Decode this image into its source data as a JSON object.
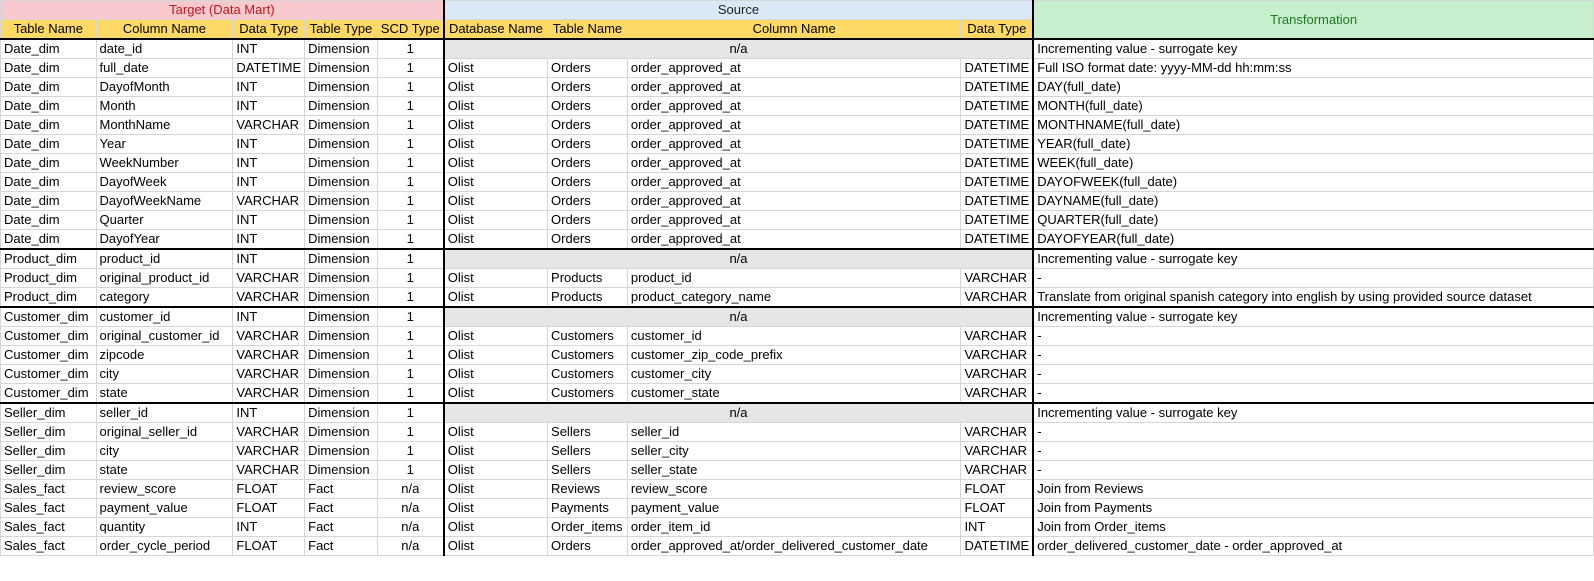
{
  "groups": {
    "target": "Target (Data Mart)",
    "source": "Source",
    "transformation": "Transformation"
  },
  "columns": {
    "target": [
      "Table Name",
      "Column Name",
      "Data Type",
      "Table Type",
      "SCD Type"
    ],
    "source": [
      "Database Name",
      "Table Name",
      "Column Name",
      "Data Type"
    ]
  },
  "colors": {
    "target_header_bg": "#f8c9cf",
    "target_header_text": "#c0181f",
    "source_header_bg": "#dbe9f7",
    "transformation_header_bg": "#c7efce",
    "transformation_header_text": "#1e7b1e",
    "column_header_bg": "#ffd966",
    "na_bg": "#e6e6e6"
  },
  "rows": [
    {
      "t": [
        "Date_dim",
        "date_id",
        "INT",
        "Dimension",
        "1"
      ],
      "na": "n/a",
      "x": "Incrementing value - surrogate key"
    },
    {
      "t": [
        "Date_dim",
        "full_date",
        "DATETIME",
        "Dimension",
        "1"
      ],
      "s": [
        "Olist",
        "Orders",
        "order_approved_at",
        "DATETIME"
      ],
      "x": "Full ISO format date: yyyy-MM-dd hh:mm:ss"
    },
    {
      "t": [
        "Date_dim",
        "DayofMonth",
        "INT",
        "Dimension",
        "1"
      ],
      "s": [
        "Olist",
        "Orders",
        "order_approved_at",
        "DATETIME"
      ],
      "x": "DAY(full_date)"
    },
    {
      "t": [
        "Date_dim",
        "Month",
        "INT",
        "Dimension",
        "1"
      ],
      "s": [
        "Olist",
        "Orders",
        "order_approved_at",
        "DATETIME"
      ],
      "x": "MONTH(full_date)"
    },
    {
      "t": [
        "Date_dim",
        "MonthName",
        "VARCHAR",
        "Dimension",
        "1"
      ],
      "s": [
        "Olist",
        "Orders",
        "order_approved_at",
        "DATETIME"
      ],
      "x": "MONTHNAME(full_date)"
    },
    {
      "t": [
        "Date_dim",
        "Year",
        "INT",
        "Dimension",
        "1"
      ],
      "s": [
        "Olist",
        "Orders",
        "order_approved_at",
        "DATETIME"
      ],
      "x": "YEAR(full_date)"
    },
    {
      "t": [
        "Date_dim",
        "WeekNumber",
        "INT",
        "Dimension",
        "1"
      ],
      "s": [
        "Olist",
        "Orders",
        "order_approved_at",
        "DATETIME"
      ],
      "x": "WEEK(full_date)"
    },
    {
      "t": [
        "Date_dim",
        "DayofWeek",
        "INT",
        "Dimension",
        "1"
      ],
      "s": [
        "Olist",
        "Orders",
        "order_approved_at",
        "DATETIME"
      ],
      "x": "DAYOFWEEK(full_date)"
    },
    {
      "t": [
        "Date_dim",
        "DayofWeekName",
        "VARCHAR",
        "Dimension",
        "1"
      ],
      "s": [
        "Olist",
        "Orders",
        "order_approved_at",
        "DATETIME"
      ],
      "x": "DAYNAME(full_date)"
    },
    {
      "t": [
        "Date_dim",
        "Quarter",
        "INT",
        "Dimension",
        "1"
      ],
      "s": [
        "Olist",
        "Orders",
        "order_approved_at",
        "DATETIME"
      ],
      "x": "QUARTER(full_date)"
    },
    {
      "t": [
        "Date_dim",
        "DayofYear",
        "INT",
        "Dimension",
        "1"
      ],
      "s": [
        "Olist",
        "Orders",
        "order_approved_at",
        "DATETIME"
      ],
      "x": "DAYOFYEAR(full_date)"
    },
    {
      "t": [
        "Product_dim",
        "product_id",
        "INT",
        "Dimension",
        "1"
      ],
      "na": "n/a",
      "x": "Incrementing value - surrogate key"
    },
    {
      "t": [
        "Product_dim",
        "original_product_id",
        "VARCHAR",
        "Dimension",
        "1"
      ],
      "s": [
        "Olist",
        "Products",
        "product_id",
        "VARCHAR"
      ],
      "x": "-"
    },
    {
      "t": [
        "Product_dim",
        "category",
        "VARCHAR",
        "Dimension",
        "1"
      ],
      "s": [
        "Olist",
        "Products",
        "product_category_name",
        "VARCHAR"
      ],
      "x": "Translate from original spanish category into english by using provided source dataset"
    },
    {
      "t": [
        "Customer_dim",
        "customer_id",
        "INT",
        "Dimension",
        "1"
      ],
      "na": "n/a",
      "x": "Incrementing value - surrogate key"
    },
    {
      "t": [
        "Customer_dim",
        "original_customer_id",
        "VARCHAR",
        "Dimension",
        "1"
      ],
      "s": [
        "Olist",
        "Customers",
        "customer_id",
        "VARCHAR"
      ],
      "x": "-"
    },
    {
      "t": [
        "Customer_dim",
        "zipcode",
        "VARCHAR",
        "Dimension",
        "1"
      ],
      "s": [
        "Olist",
        "Customers",
        "customer_zip_code_prefix",
        "VARCHAR"
      ],
      "x": "-"
    },
    {
      "t": [
        "Customer_dim",
        "city",
        "VARCHAR",
        "Dimension",
        "1"
      ],
      "s": [
        "Olist",
        "Customers",
        "customer_city",
        "VARCHAR"
      ],
      "x": "-"
    },
    {
      "t": [
        "Customer_dim",
        "state",
        "VARCHAR",
        "Dimension",
        "1"
      ],
      "s": [
        "Olist",
        "Customers",
        "customer_state",
        "VARCHAR"
      ],
      "x": "-"
    },
    {
      "t": [
        "Seller_dim",
        "seller_id",
        "INT",
        "Dimension",
        "1"
      ],
      "na": "n/a",
      "x": "Incrementing value - surrogate key"
    },
    {
      "t": [
        "Seller_dim",
        "original_seller_id",
        "VARCHAR",
        "Dimension",
        "1"
      ],
      "s": [
        "Olist",
        "Sellers",
        "seller_id",
        "VARCHAR"
      ],
      "x": "-"
    },
    {
      "t": [
        "Seller_dim",
        "city",
        "VARCHAR",
        "Dimension",
        "1"
      ],
      "s": [
        "Olist",
        "Sellers",
        "seller_city",
        "VARCHAR"
      ],
      "x": "-"
    },
    {
      "t": [
        "Seller_dim",
        "state",
        "VARCHAR",
        "Dimension",
        "1"
      ],
      "s": [
        "Olist",
        "Sellers",
        "seller_state",
        "VARCHAR"
      ],
      "x": "-"
    },
    {
      "t": [
        "Sales_fact",
        "review_score",
        "FLOAT",
        "Fact",
        "n/a"
      ],
      "s": [
        "Olist",
        "Reviews",
        "review_score",
        "FLOAT"
      ],
      "x": "Join from Reviews"
    },
    {
      "t": [
        "Sales_fact",
        "payment_value",
        "FLOAT",
        "Fact",
        "n/a"
      ],
      "s": [
        "Olist",
        "Payments",
        "payment_value",
        "FLOAT"
      ],
      "x": "Join from Payments"
    },
    {
      "t": [
        "Sales_fact",
        "quantity",
        "INT",
        "Fact",
        "n/a"
      ],
      "s": [
        "Olist",
        "Order_items",
        "order_item_id",
        "INT"
      ],
      "x": "Join from Order_items"
    },
    {
      "t": [
        "Sales_fact",
        "order_cycle_period",
        "FLOAT",
        "Fact",
        "n/a"
      ],
      "s": [
        "Olist",
        "Orders",
        "order_approved_at/order_delivered_customer_date",
        "DATETIME"
      ],
      "x": "order_delivered_customer_date -  order_approved_at"
    }
  ]
}
